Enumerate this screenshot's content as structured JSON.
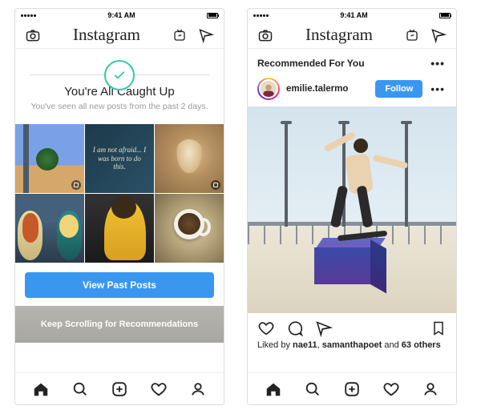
{
  "status": {
    "carrier_dots": 5,
    "time": "9:41 AM",
    "battery": "100%"
  },
  "app": {
    "logo_text": "Instagram"
  },
  "phone1": {
    "caught_title": "You're All Caught Up",
    "caught_sub": "You've seen all new posts from the past 2 days.",
    "thumb2_quote": "I am not afraid... I was born to do this.",
    "view_past_label": "View Past Posts",
    "keep_scroll_label": "Keep Scrolling for Recommendations"
  },
  "phone2": {
    "rec_title": "Recommended For You",
    "post_username": "emilie.talermo",
    "follow_label": "Follow",
    "likes_prefix": "Liked by ",
    "liker1": "nae11",
    "likes_sep": ", ",
    "liker2": "samanthapoet",
    "likes_and": " and ",
    "others_count": "63 others"
  },
  "tabs": [
    "home",
    "search",
    "add",
    "activity",
    "profile"
  ]
}
